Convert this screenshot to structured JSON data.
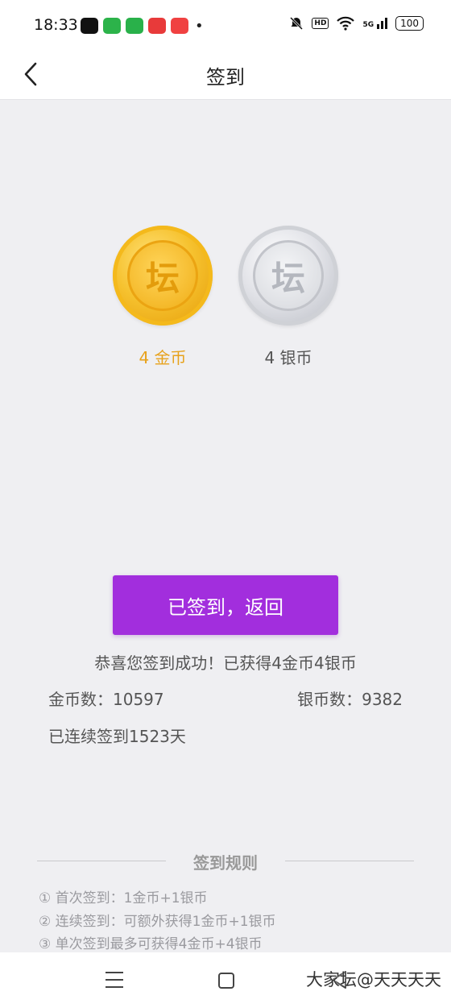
{
  "status_bar": {
    "time": "18:33",
    "hd": "HD",
    "network": "5G",
    "battery": "100"
  },
  "nav": {
    "title": "签到"
  },
  "coins": {
    "gold_symbol": "坛",
    "silver_symbol": "坛",
    "gold_label": "4 金币",
    "silver_label": "4 银币"
  },
  "actions": {
    "signed_button": "已签到，返回"
  },
  "result": {
    "success_message": "恭喜您签到成功！已获得4金币4银币",
    "gold_count": "金币数：10597",
    "silver_count": "银币数：9382",
    "streak": "已连续签到1523天"
  },
  "rules": {
    "title": "签到规则",
    "items": [
      "① 首次签到：1金币+1银币",
      "② 连续签到：可额外获得1金币+1银币",
      "③ 单次签到最多可获得4金币+4银币"
    ]
  },
  "watermark": "大家坛@天天天天",
  "colors": {
    "accent_purple": "#a22edd",
    "gold": "#e7a21c",
    "background": "#efeff2"
  }
}
